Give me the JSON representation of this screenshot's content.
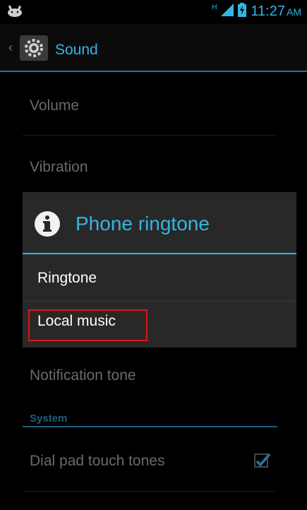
{
  "status_bar": {
    "network": "H",
    "time": "11:27",
    "ampm": "AM"
  },
  "action_bar": {
    "title": "Sound"
  },
  "settings": {
    "volume": "Volume",
    "vibration": "Vibration",
    "notification_tone": "Notification tone",
    "system_section": "System",
    "dial_pad": "Dial pad touch tones",
    "dial_pad_checked": true
  },
  "dialog": {
    "title": "Phone ringtone",
    "options": [
      "Ringtone",
      "Local music"
    ]
  },
  "colors": {
    "accent": "#33b5e5",
    "highlight": "#e01414"
  }
}
